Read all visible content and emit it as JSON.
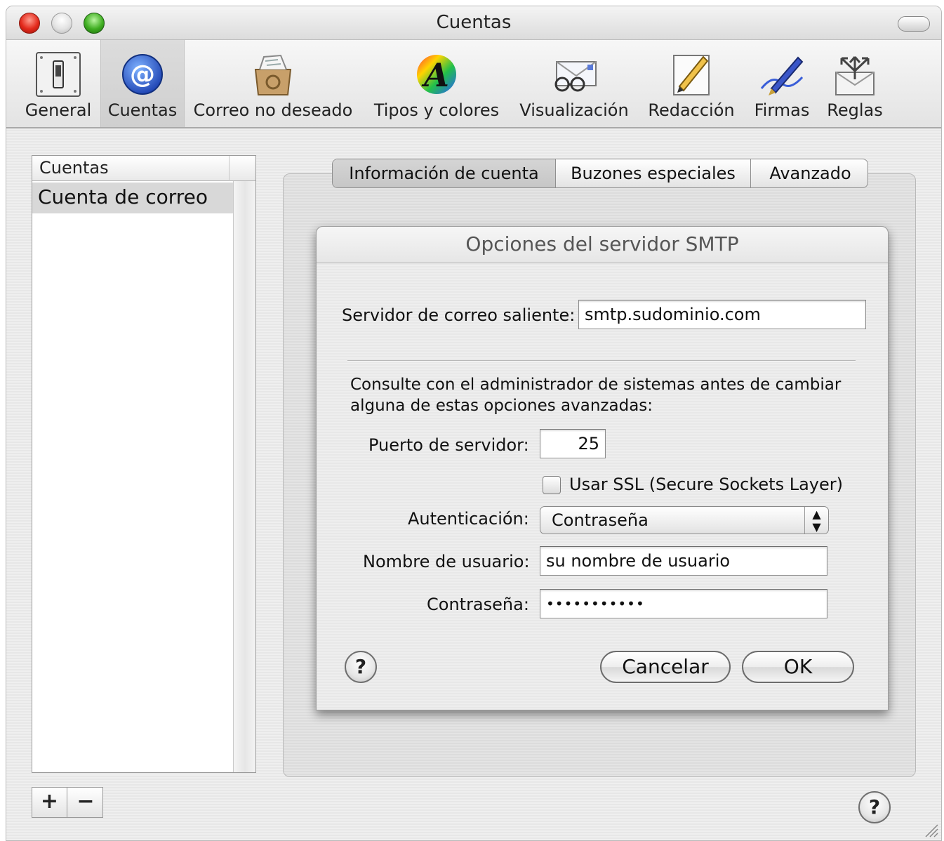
{
  "window": {
    "title": "Cuentas"
  },
  "toolbar": {
    "items": [
      {
        "label": "General",
        "icon": "switch-icon"
      },
      {
        "label": "Cuentas",
        "icon": "at-sign-icon",
        "selected": true
      },
      {
        "label": "Correo no deseado",
        "icon": "junk-mail-icon"
      },
      {
        "label": "Tipos y colores",
        "icon": "fonts-colors-icon"
      },
      {
        "label": "Visualización",
        "icon": "glasses-envelope-icon"
      },
      {
        "label": "Redacción",
        "icon": "pencil-paper-icon"
      },
      {
        "label": "Firmas",
        "icon": "fountain-pen-icon"
      },
      {
        "label": "Reglas",
        "icon": "rules-arrows-icon"
      }
    ]
  },
  "accounts": {
    "header": "Cuentas",
    "rows": [
      "Cuenta de correo"
    ],
    "add_label": "+",
    "remove_label": "−"
  },
  "tabs": {
    "items": [
      "Información de cuenta",
      "Buzones especiales",
      "Avanzado"
    ],
    "selected": "Información de cuenta"
  },
  "sheet": {
    "title": "Opciones del servidor SMTP",
    "outgoing_server_label": "Servidor de correo saliente:",
    "outgoing_server_value": "smtp.sudominio.com",
    "note_line1": "Consulte con el administrador de sistemas antes de cambiar",
    "note_line2": "alguna de estas opciones avanzadas:",
    "port_label": "Puerto de servidor:",
    "port_value": "25",
    "ssl_label": "Usar SSL (Secure Sockets Layer)",
    "ssl_checked": false,
    "auth_label": "Autenticación:",
    "auth_value": "Contraseña",
    "username_label": "Nombre de usuario:",
    "username_value": "su nombre de usuario",
    "password_label": "Contraseña:",
    "password_value": "•••••••••••",
    "help_label": "?",
    "cancel_label": "Cancelar",
    "ok_label": "OK"
  },
  "window_help_label": "?"
}
